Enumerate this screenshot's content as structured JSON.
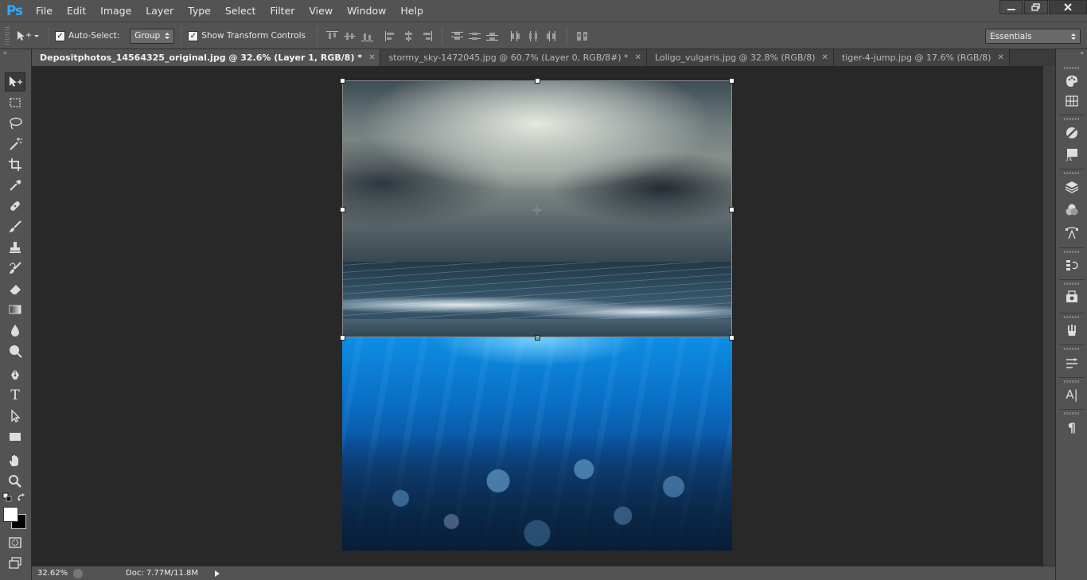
{
  "app": {
    "logo": "Ps"
  },
  "menu": [
    "File",
    "Edit",
    "Image",
    "Layer",
    "Type",
    "Select",
    "Filter",
    "View",
    "Window",
    "Help"
  ],
  "window_controls": {
    "minimize": "minimize",
    "restore": "restore",
    "close": "close"
  },
  "options": {
    "auto_select_label": "Auto-Select:",
    "auto_select_checked": true,
    "auto_select_target": "Group",
    "show_transform_label": "Show Transform Controls",
    "show_transform_checked": true,
    "workspace": "Essentials"
  },
  "tabs": [
    {
      "label": "Depositphotos_14564325_original.jpg @ 32.6% (Layer 1, RGB/8) *",
      "active": true
    },
    {
      "label": "stormy_sky-1472045.jpg @ 60.7% (Layer 0, RGB/8#) *",
      "active": false
    },
    {
      "label": "Loligo_vulgaris.jpg @ 32.8% (RGB/8)",
      "active": false
    },
    {
      "label": "tiger-4-jump.jpg @ 17.6% (RGB/8)",
      "active": false
    }
  ],
  "tools": [
    "move-tool",
    "marquee-tool",
    "lasso-tool",
    "magic-wand-tool",
    "crop-tool",
    "eyedropper-tool",
    "healing-brush-tool",
    "brush-tool",
    "clone-stamp-tool",
    "history-brush-tool",
    "eraser-tool",
    "gradient-tool",
    "blur-tool",
    "dodge-tool",
    "pen-tool",
    "type-tool",
    "path-selection-tool",
    "rectangle-tool",
    "hand-tool",
    "zoom-tool"
  ],
  "tool_letter_type": "T",
  "colors": {
    "foreground": "#ffffff",
    "background": "#000000",
    "accent": "#31a8ff"
  },
  "status": {
    "zoom": "32.62%",
    "doc": "Doc: 7.77M/11.8M"
  },
  "right_panels": [
    "color-panel",
    "swatches-panel",
    "adjustments-panel",
    "styles-panel",
    "layers-panel",
    "channels-panel",
    "paths-panel",
    "history-panel",
    "properties-panel",
    "brush-presets-panel",
    "tool-presets-panel",
    "character-panel",
    "paragraph-panel"
  ],
  "right_text": {
    "character": "A|",
    "paragraph": "¶"
  }
}
